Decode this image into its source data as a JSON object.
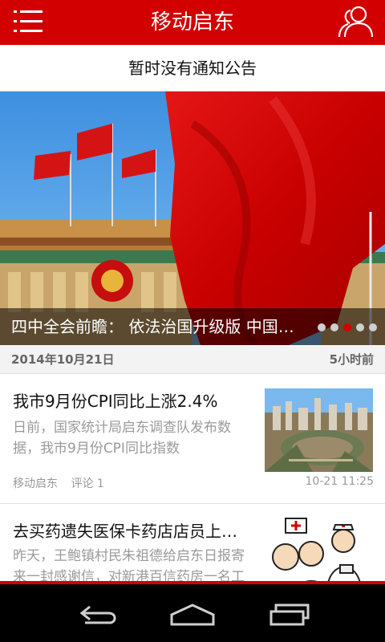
{
  "header": {
    "title": "移动启东",
    "menu_icon": "hamburger-menu-icon",
    "user_icon": "users-icon",
    "bg": "#d20000"
  },
  "notice": {
    "text": "暂时没有通知公告"
  },
  "banner": {
    "caption": "四中全会前瞻： 依法治国升级版 中国…",
    "slide_count": 5,
    "active_slide": 3
  },
  "date_bar": {
    "date": "2014年10月21日",
    "relative": "5小时前"
  },
  "news": [
    {
      "title": "我市9月份CPI同比上涨2.4%",
      "summary": " 日前，国家统计局启东调查队发布数据，我市9月份CPI同比指数",
      "source": "移动启东",
      "comments": "评论 1",
      "time": "10-21 11:25"
    },
    {
      "title": "去买药遗失医保卡药店店员上…",
      "summary": "昨天，王鲍镇村民朱祖德给启东日报寄来一封感谢信，对新港百信药房一名工"
    }
  ],
  "system_nav": {
    "back": "back-arrow-icon",
    "home": "home-icon",
    "recent": "recent-apps-icon"
  }
}
